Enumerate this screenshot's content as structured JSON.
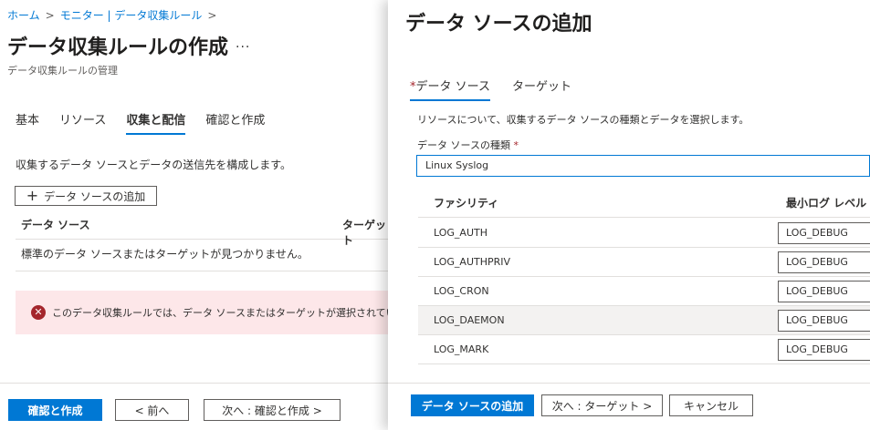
{
  "breadcrumb": {
    "home": "ホーム",
    "parent": "モニター | データ収集ルール",
    "sep": ">"
  },
  "page": {
    "title": "データ収集ルールの作成",
    "more": "...",
    "subtitle": "データ収集ルールの管理"
  },
  "tabs": [
    {
      "label": "基本"
    },
    {
      "label": "リソース"
    },
    {
      "label": "収集と配信"
    },
    {
      "label": "確認と作成"
    }
  ],
  "collect": {
    "description": "収集するデータ ソースとデータの送信先を構成します。",
    "add_button": "データ ソースの追加",
    "columns": [
      "データ ソース",
      "ターゲット"
    ],
    "empty_text": "標準のデータ ソースまたはターゲットが見つかりません。",
    "error_text": "このデータ収集ルールでは、データ ソースまたはターゲットが選択されていません。"
  },
  "footer": {
    "review_create": "確認と作成",
    "prev": "< 前へ",
    "next": "次へ : 確認と作成 >"
  },
  "panel": {
    "title": "データ ソースの追加",
    "tabs": [
      {
        "label": "データ ソース",
        "required": "*"
      },
      {
        "label": "ターゲット"
      }
    ],
    "description": "リソースについて、収集するデータ ソースの種類とデータを選択します。",
    "type_label": "データ ソースの種類",
    "type_required": "*",
    "type_value": "Linux Syslog",
    "columns": [
      "ファシリティ",
      "最小ログ レベル"
    ],
    "rows": [
      {
        "facility": "LOG_AUTH",
        "level": "LOG_DEBUG"
      },
      {
        "facility": "LOG_AUTHPRIV",
        "level": "LOG_DEBUG"
      },
      {
        "facility": "LOG_CRON",
        "level": "LOG_DEBUG"
      },
      {
        "facility": "LOG_DAEMON",
        "level": "LOG_DEBUG"
      },
      {
        "facility": "LOG_MARK",
        "level": "LOG_DEBUG"
      }
    ],
    "footer": {
      "add": "データ ソースの追加",
      "next": "次へ : ターゲット >",
      "cancel": "キャンセル"
    }
  },
  "colors": {
    "accent": "#0078d4",
    "error": "#a4262c",
    "error_bg": "#fde7e9"
  }
}
